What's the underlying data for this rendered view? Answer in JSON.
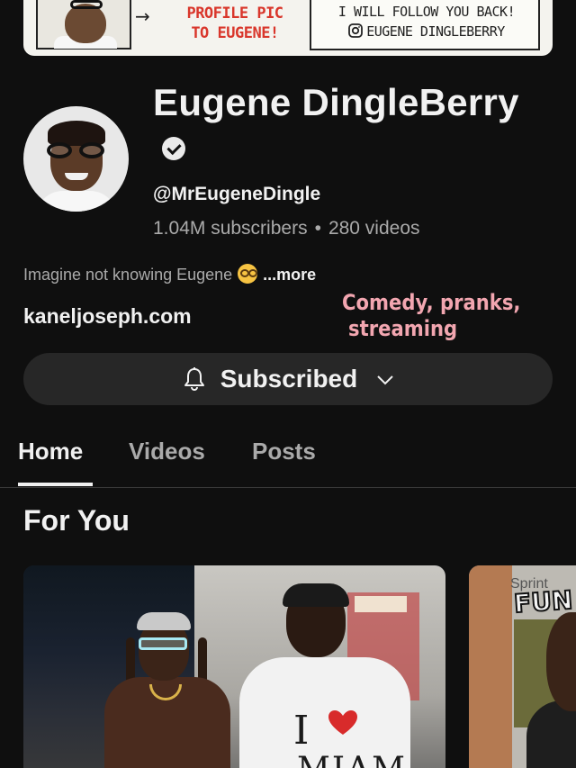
{
  "banner": {
    "red_text_line1": "PROFILE PIC",
    "red_text_line2": "TO EUGENE!",
    "black_text_line1": "I WILL FOLLOW YOU BACK!",
    "black_text_line2": "EUGENE DINGLEBERRY",
    "instagram_icon": "instagram-icon",
    "arrow": "→"
  },
  "channel": {
    "name": "Eugene DingleBerry",
    "verified": true,
    "handle": "@MrEugeneDingle",
    "subscribers": "1.04M subscribers",
    "separator": "•",
    "videos": "280 videos",
    "description": "Imagine not knowing Eugene",
    "description_emoji": "nerd-face-emoji",
    "more_label": "...more",
    "link": "kaneljoseph.com"
  },
  "annotation": {
    "line1": "Comedy, pranks,",
    "line2": "streaming",
    "color": "#f2a6b0"
  },
  "subscribe_button": {
    "label": "Subscribed",
    "icon": "bell-icon",
    "dropdown_icon": "chevron-down-icon"
  },
  "tabs": [
    {
      "label": "Home",
      "active": true
    },
    {
      "label": "Videos",
      "active": false
    },
    {
      "label": "Posts",
      "active": false
    }
  ],
  "section": {
    "title": "For You"
  },
  "thumbnails": [
    {
      "shirt_letter": "I",
      "shirt_text": "MIAM"
    },
    {
      "sign_text": "Sprint",
      "overlay_text": "FUN"
    }
  ],
  "colors": {
    "background": "#0f0f0f",
    "text_primary": "#f1f1f1",
    "text_secondary": "#aaaaaa",
    "button_bg": "#272727",
    "banner_red": "#d9362b"
  }
}
